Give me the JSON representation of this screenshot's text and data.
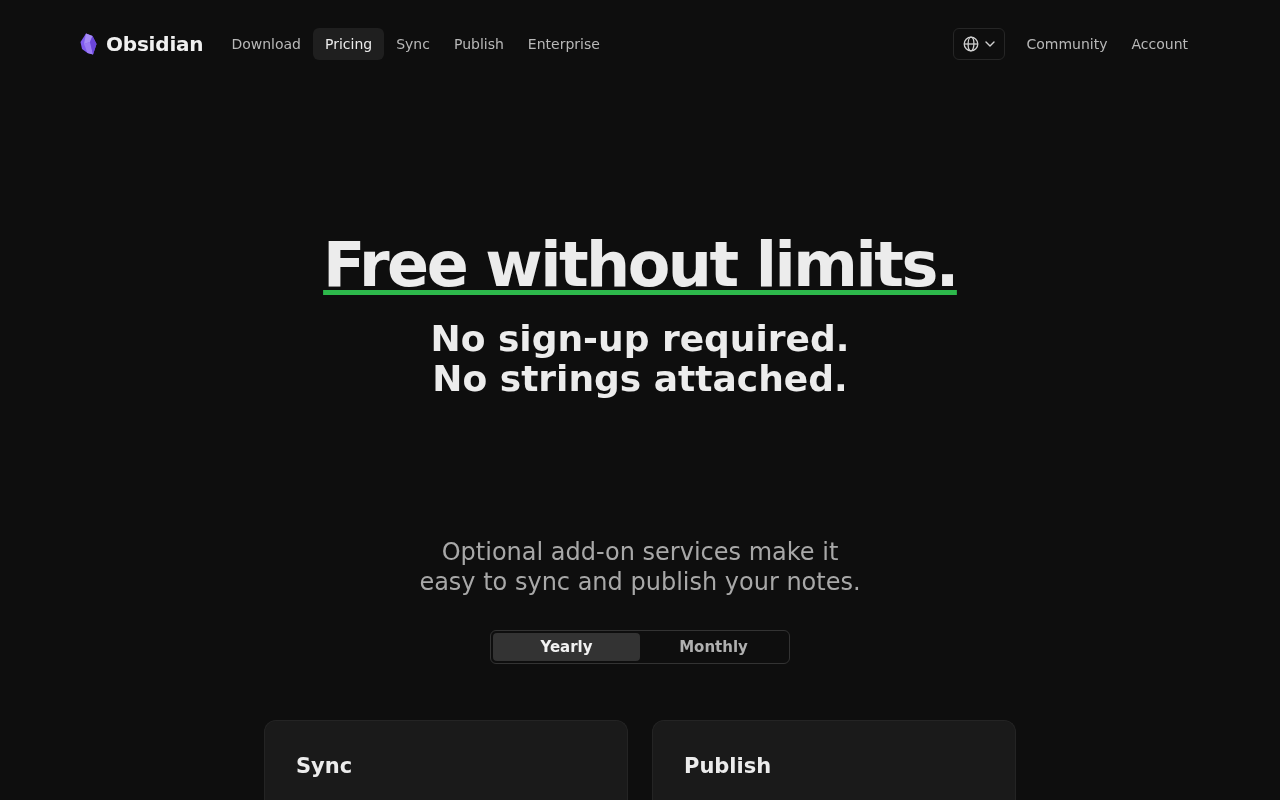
{
  "nav": {
    "logo": "Obsidian",
    "links": [
      {
        "label": "Download",
        "selected": false
      },
      {
        "label": "Pricing",
        "selected": true
      },
      {
        "label": "Sync",
        "selected": false
      },
      {
        "label": "Publish",
        "selected": false
      },
      {
        "label": "Enterprise",
        "selected": false
      }
    ],
    "right_links": [
      {
        "label": "Community"
      },
      {
        "label": "Account"
      }
    ]
  },
  "hero": {
    "title": "Free without limits.",
    "subtitle_lines": [
      "No sign-up required.",
      "No strings attached."
    ]
  },
  "intro": {
    "text": "Optional add-on services make it easy to sync and publish your notes."
  },
  "billing_toggle": [
    {
      "label": "Yearly",
      "selected": true
    },
    {
      "label": "Monthly",
      "selected": false
    }
  ],
  "plans": [
    {
      "title": "Sync"
    },
    {
      "title": "Publish"
    }
  ]
}
